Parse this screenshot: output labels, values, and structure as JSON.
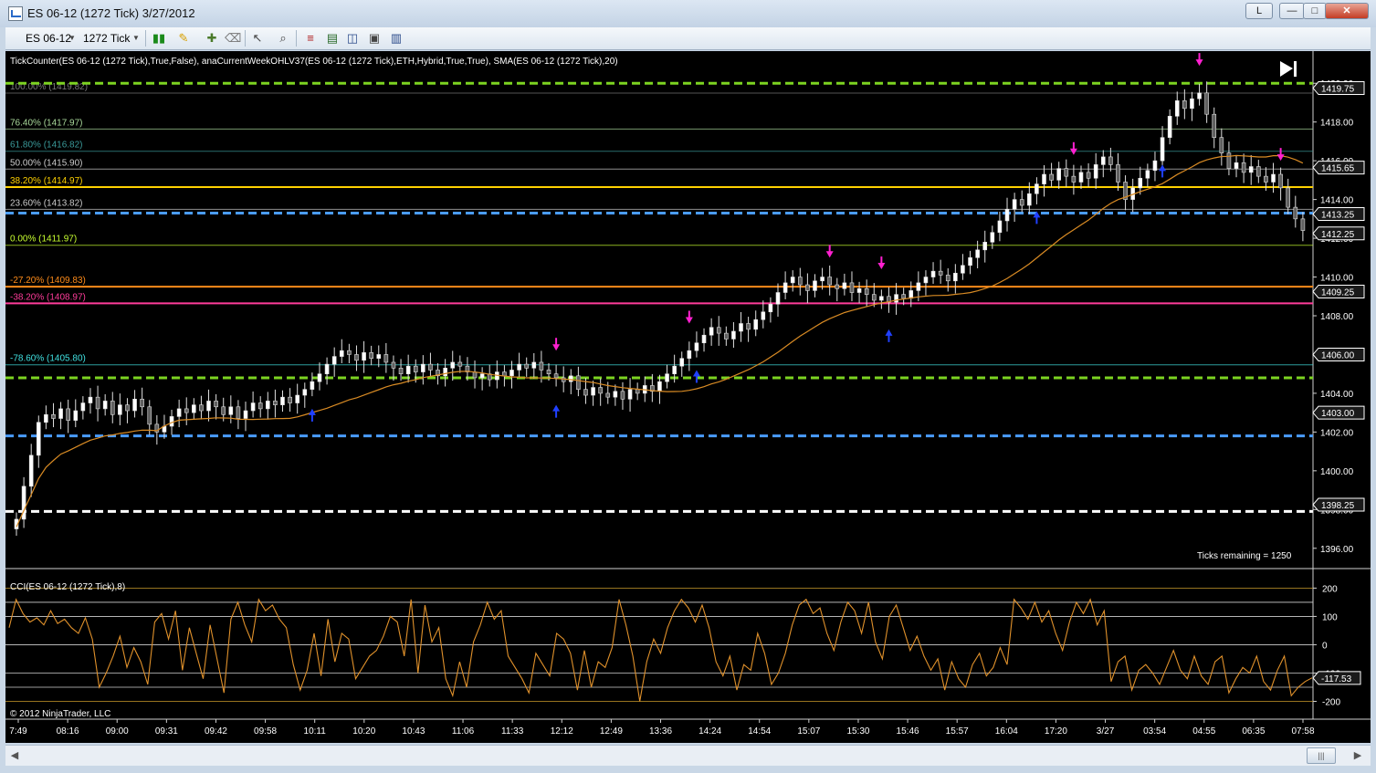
{
  "window": {
    "title": "ES 06-12 (1272 Tick)  3/27/2012",
    "buttons": {
      "link": "L",
      "minimize": "—",
      "maximize": "□",
      "close": "✕"
    }
  },
  "toolbar": {
    "instrument": "ES 06-12",
    "period": "1272 Tick",
    "icons": [
      "bar-type-icon",
      "pencil-draw-icon",
      "crosshair-icon",
      "pointer-icon",
      "zoom-icon",
      "strategies-icon",
      "indicators-icon",
      "chart-properties-icon",
      "screenshot-icon",
      "data-box-icon"
    ]
  },
  "chart_data": {
    "type": "candlestick",
    "indicator_label": "TickCounter(ES 06-12 (1272 Tick),True,False), anaCurrentWeekOHLV37(ES 06-12 (1272 Tick),ETH,Hybrid,True,True), SMA(ES 06-12 (1272 Tick),20)",
    "ylim": [
      1395,
      1421
    ],
    "price_ticks": [
      "1396.00",
      "1398.00",
      "1400.00",
      "1402.00",
      "1404.00",
      "1406.00",
      "1408.00",
      "1410.00",
      "1412.00",
      "1414.00",
      "1416.00",
      "1418.00",
      "1420.00"
    ],
    "price_tags": [
      {
        "price": 1419.75,
        "label": "1419.75",
        "color": "#ffffff"
      },
      {
        "price": 1415.65,
        "label": "1415.65",
        "color": "#ffffff"
      },
      {
        "price": 1413.25,
        "label": "1413.25",
        "color": "#ffffff"
      },
      {
        "price": 1412.25,
        "label": "1412.25",
        "color": "#ffffff"
      },
      {
        "price": 1409.25,
        "label": "1409.25",
        "color": "#ffffff"
      },
      {
        "price": 1406.0,
        "label": "1406.00",
        "color": "#ffffff"
      },
      {
        "price": 1403.0,
        "label": "1403.00",
        "color": "#ffffff"
      },
      {
        "price": 1398.25,
        "label": "1398.25",
        "color": "#ffffff"
      }
    ],
    "fib_levels": [
      {
        "label": "100.00% (1419.82)",
        "price": 1419.82,
        "color": "#7a7a7a"
      },
      {
        "label": "76.40% (1417.97)",
        "price": 1417.97,
        "color": "#a8d89a"
      },
      {
        "label": "61.80% (1416.82)",
        "price": 1416.82,
        "color": "#3a9a9a"
      },
      {
        "label": "50.00% (1415.90)",
        "price": 1415.9,
        "color": "#cccccc"
      },
      {
        "label": "38.20% (1414.97)",
        "price": 1414.97,
        "color": "#ffd200"
      },
      {
        "label": "23.60% (1413.82)",
        "price": 1413.82,
        "color": "#cccccc"
      },
      {
        "label": "0.00% (1411.97)",
        "price": 1411.97,
        "color": "#c8ff30"
      },
      {
        "label": "-27.20% (1409.83)",
        "price": 1409.83,
        "color": "#ff8c1a"
      },
      {
        "label": "-38.20% (1408.97)",
        "price": 1408.97,
        "color": "#ff3c9a"
      },
      {
        "label": "-78.60% (1405.80)",
        "price": 1405.8,
        "color": "#40e0e0"
      }
    ],
    "dashed_levels": [
      {
        "price": 1420.0,
        "color": "#7cd321"
      },
      {
        "price": 1413.3,
        "color": "#4a9cff"
      },
      {
        "price": 1404.8,
        "color": "#7cd321"
      },
      {
        "price": 1401.8,
        "color": "#4a9cff"
      },
      {
        "price": 1397.9,
        "color": "#ffffff"
      }
    ],
    "closes": [
      1397.5,
      1399.2,
      1400.8,
      1402.5,
      1402.9,
      1402.7,
      1403.2,
      1402.6,
      1403.1,
      1403.5,
      1403.8,
      1403.2,
      1403.6,
      1402.9,
      1403.4,
      1403.1,
      1403.7,
      1403.3,
      1402.4,
      1402.0,
      1402.3,
      1402.8,
      1403.2,
      1403.0,
      1403.4,
      1403.1,
      1403.6,
      1403.3,
      1402.9,
      1403.3,
      1402.7,
      1403.1,
      1403.5,
      1403.2,
      1403.6,
      1403.4,
      1403.8,
      1403.5,
      1403.9,
      1404.2,
      1404.6,
      1405.0,
      1405.5,
      1405.9,
      1406.2,
      1406.0,
      1405.7,
      1406.1,
      1405.8,
      1406.0,
      1405.6,
      1405.3,
      1405.0,
      1405.4,
      1405.1,
      1405.5,
      1405.2,
      1404.9,
      1405.3,
      1405.6,
      1405.4,
      1405.1,
      1404.8,
      1405.0,
      1404.7,
      1405.1,
      1404.9,
      1405.2,
      1405.5,
      1405.3,
      1405.6,
      1405.2,
      1405.0,
      1404.8,
      1404.6,
      1404.9,
      1404.2,
      1403.9,
      1404.3,
      1404.0,
      1403.8,
      1404.1,
      1403.7,
      1404.2,
      1404.0,
      1404.4,
      1404.1,
      1404.6,
      1405.0,
      1405.4,
      1405.8,
      1406.2,
      1406.6,
      1407.0,
      1407.4,
      1407.1,
      1406.8,
      1407.2,
      1407.6,
      1407.3,
      1407.8,
      1408.2,
      1408.6,
      1409.2,
      1409.7,
      1410.0,
      1409.6,
      1409.3,
      1409.8,
      1410.0,
      1409.6,
      1409.4,
      1409.7,
      1409.2,
      1409.4,
      1409.1,
      1408.8,
      1409.0,
      1408.7,
      1409.1,
      1408.9,
      1409.3,
      1409.7,
      1410.0,
      1410.3,
      1410.1,
      1409.8,
      1410.2,
      1410.6,
      1411.0,
      1411.4,
      1411.8,
      1412.3,
      1412.9,
      1413.5,
      1414.0,
      1413.7,
      1414.3,
      1414.8,
      1415.3,
      1415.0,
      1415.6,
      1415.2,
      1414.9,
      1415.4,
      1415.1,
      1415.8,
      1416.2,
      1415.8,
      1414.9,
      1414.0,
      1414.6,
      1415.1,
      1415.5,
      1416.0,
      1417.2,
      1418.3,
      1419.1,
      1418.7,
      1419.2,
      1419.5,
      1418.4,
      1417.2,
      1416.4,
      1415.6,
      1415.9,
      1415.4,
      1415.7,
      1415.2,
      1414.9,
      1415.3,
      1414.6,
      1413.6,
      1413.0,
      1412.4
    ],
    "sma_label": "SMA(20)",
    "up_arrows": [
      40,
      73,
      92,
      118,
      138,
      155,
      176,
      181,
      186,
      214,
      226
    ],
    "down_arrows": [
      73,
      91,
      110,
      117,
      143,
      160,
      171,
      185,
      194,
      202
    ],
    "time_labels": [
      "7:49",
      "08:16",
      "09:00",
      "09:31",
      "09:42",
      "09:58",
      "10:11",
      "10:20",
      "10:43",
      "11:06",
      "11:33",
      "12:12",
      "12:49",
      "13:36",
      "14:24",
      "14:54",
      "15:07",
      "15:30",
      "15:46",
      "15:57",
      "16:04",
      "17:20",
      "3/27",
      "03:54",
      "04:55",
      "06:35",
      "07:58"
    ],
    "ticks_remaining": "Ticks remaining = 1250",
    "copyright": "© 2012 NinjaTrader, LLC",
    "cci": {
      "label": "CCI(ES 06-12 (1272 Tick),8)",
      "ylim": [
        -250,
        240
      ],
      "ticks": [
        "200",
        "100",
        "0",
        "-100",
        "-200"
      ],
      "levels": [
        200,
        150,
        100,
        0,
        -100,
        -150,
        -200
      ],
      "current_label": "-117.53",
      "current_value": -117.53,
      "values": [
        60,
        160,
        110,
        80,
        95,
        70,
        120,
        75,
        90,
        60,
        40,
        95,
        20,
        -150,
        -100,
        -40,
        30,
        -80,
        -10,
        -60,
        -140,
        80,
        110,
        20,
        120,
        -90,
        60,
        -30,
        -120,
        70,
        -50,
        -170,
        90,
        150,
        70,
        10,
        160,
        120,
        140,
        90,
        60,
        -70,
        -160,
        -90,
        40,
        -110,
        90,
        -60,
        40,
        20,
        -120,
        -80,
        -40,
        -20,
        30,
        100,
        80,
        -40,
        160,
        -100,
        140,
        10,
        60,
        -120,
        -180,
        -60,
        -150,
        10,
        70,
        150,
        90,
        120,
        -40,
        -80,
        -120,
        -170,
        -30,
        -70,
        -110,
        40,
        20,
        -30,
        -160,
        -20,
        -150,
        -60,
        -80,
        -10,
        160,
        70,
        -40,
        -200,
        -60,
        20,
        -30,
        60,
        120,
        160,
        130,
        80,
        140,
        60,
        -60,
        -110,
        -40,
        -160,
        -70,
        -90,
        40,
        -30,
        -140,
        -100,
        -30,
        70,
        140,
        160,
        110,
        130,
        40,
        -20,
        80,
        150,
        120,
        40,
        150,
        10,
        -50,
        100,
        140,
        60,
        -20,
        30,
        -40,
        -90,
        -50,
        -160,
        -60,
        -120,
        -150,
        -70,
        -30,
        -110,
        -80,
        -10,
        -70,
        160,
        130,
        90,
        150,
        80,
        120,
        40,
        -20,
        80,
        150,
        110,
        160,
        70,
        120,
        -130,
        -60,
        -40,
        -160,
        -90,
        -70,
        -100,
        -140,
        -80,
        -20,
        -90,
        -120,
        -40,
        -110,
        -140,
        -60,
        -40,
        -170,
        -120,
        -80,
        -100,
        -40,
        -130,
        -160,
        -90,
        -40,
        -180,
        -150,
        -130,
        -117
      ]
    }
  }
}
